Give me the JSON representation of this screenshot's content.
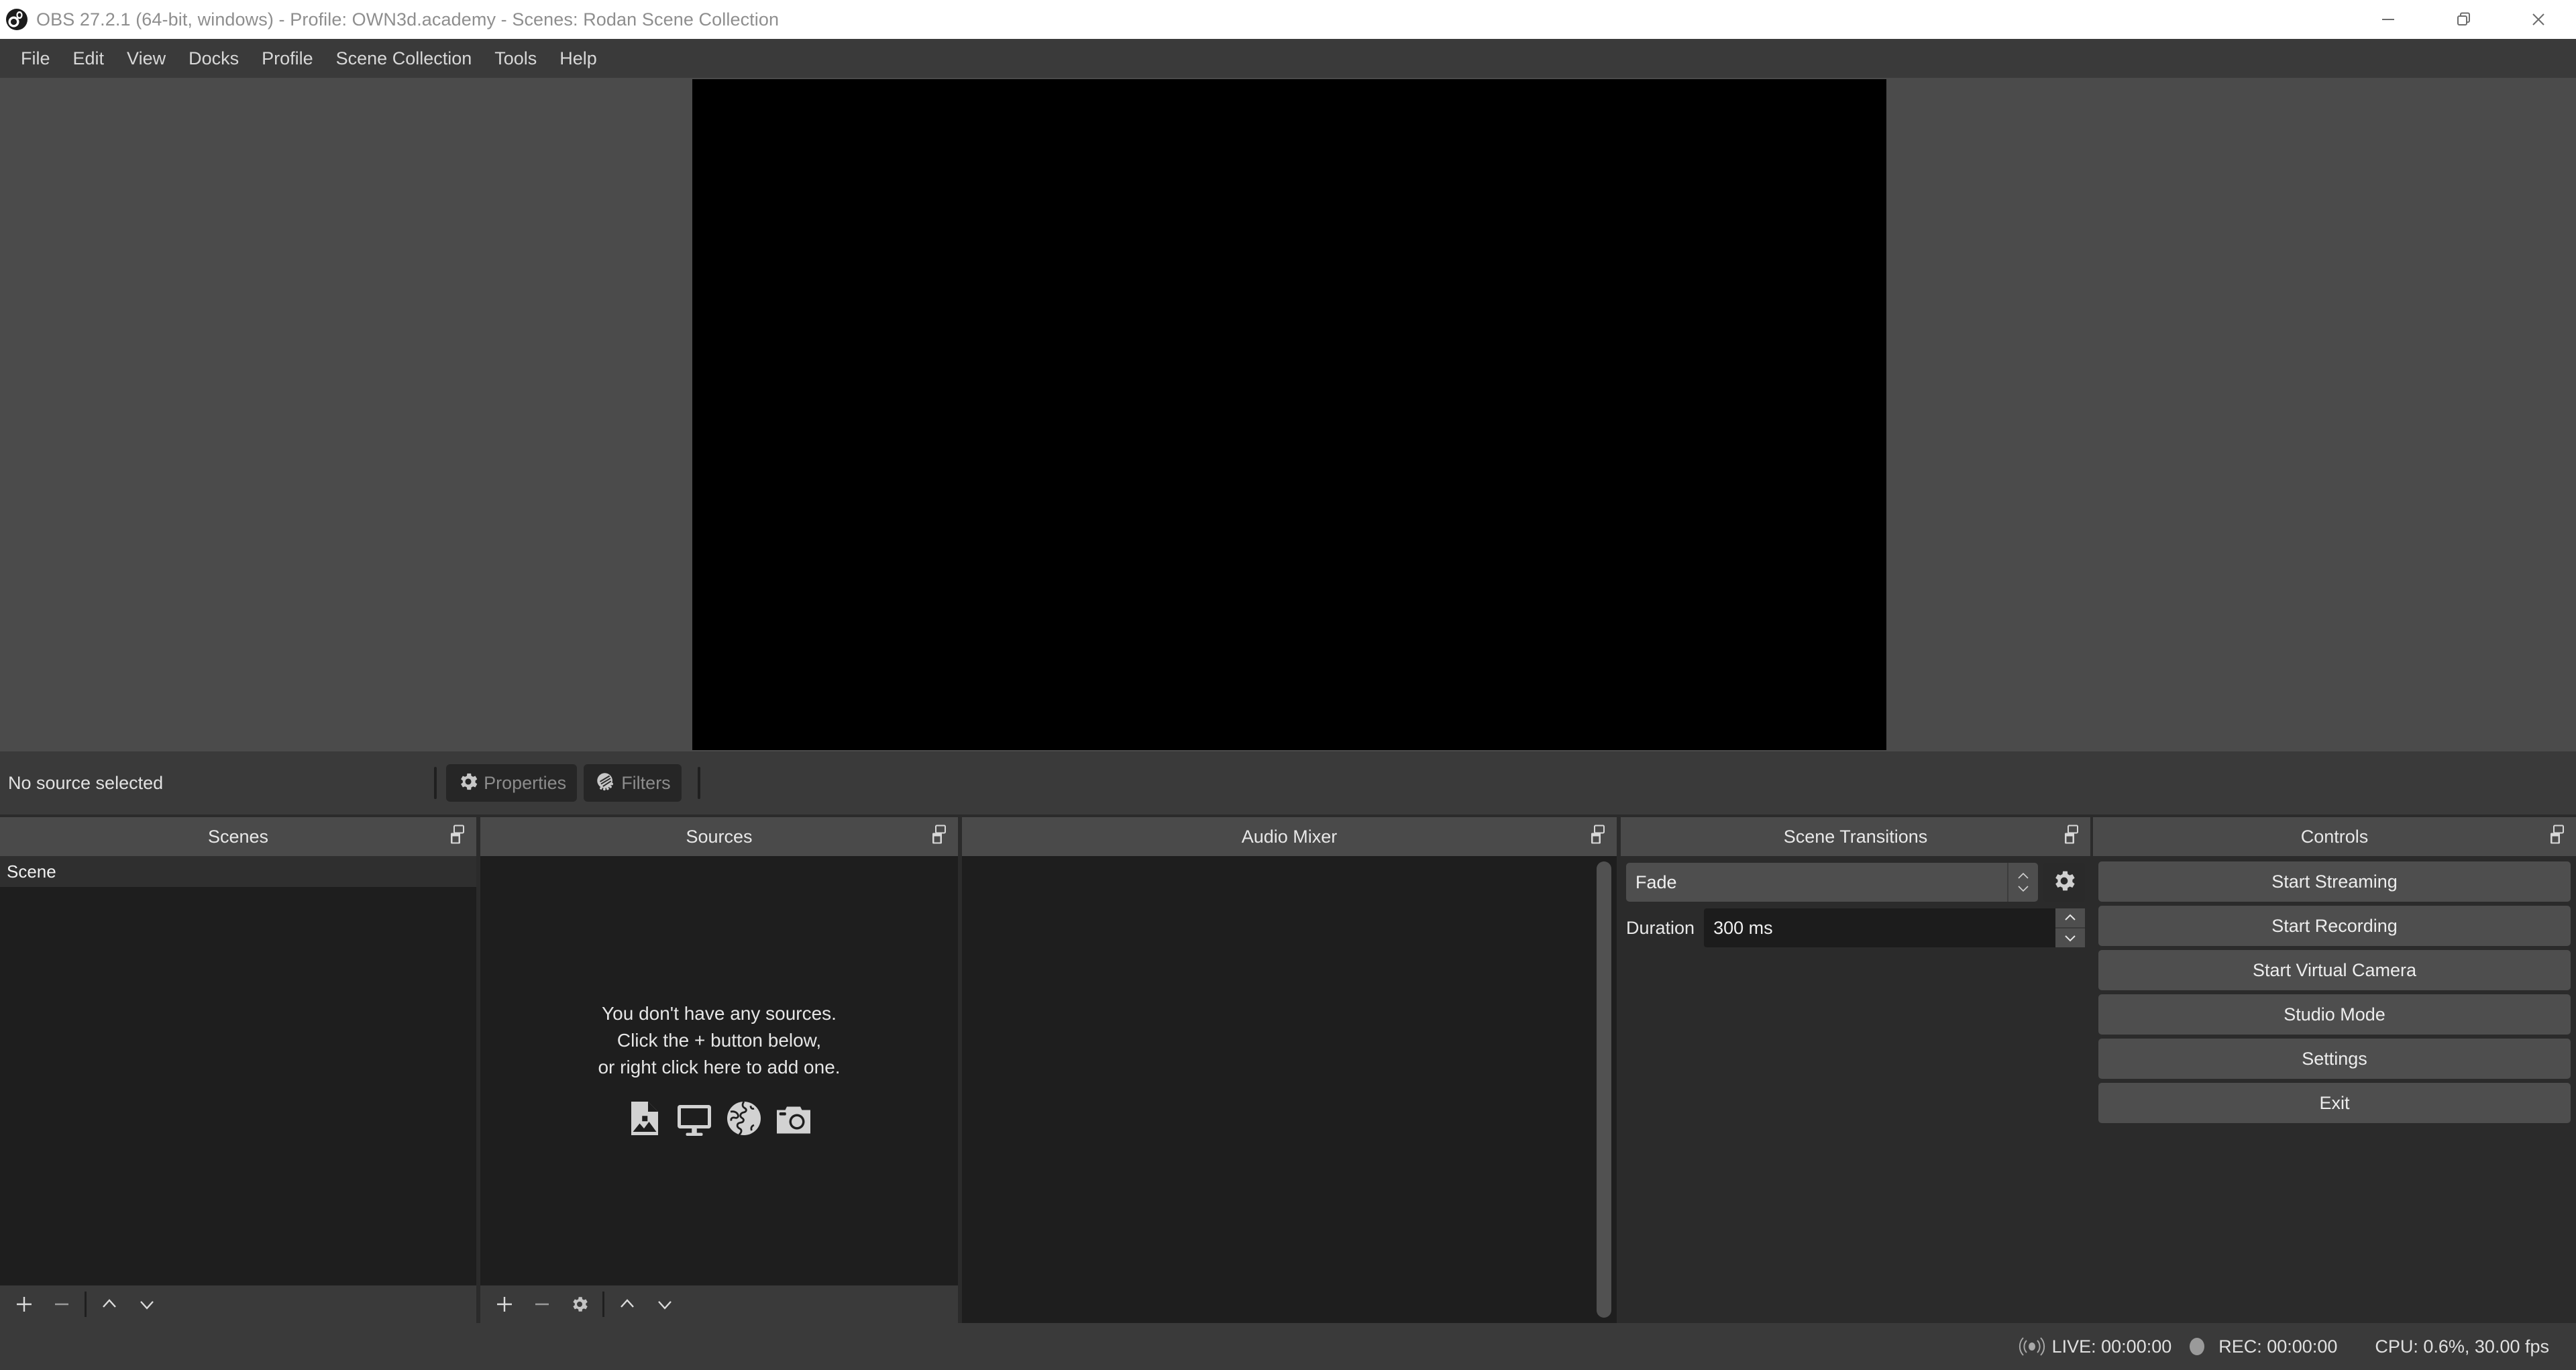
{
  "titlebar": {
    "title": "OBS 27.2.1 (64-bit, windows) - Profile: OWN3d.academy - Scenes: Rodan Scene Collection",
    "logo_icon": "obs-logo-icon",
    "minimize_icon": "minimize-icon",
    "restore_icon": "restore-icon",
    "close_icon": "close-icon"
  },
  "menubar": {
    "items": [
      {
        "label": "File"
      },
      {
        "label": "Edit"
      },
      {
        "label": "View"
      },
      {
        "label": "Docks"
      },
      {
        "label": "Profile"
      },
      {
        "label": "Scene Collection"
      },
      {
        "label": "Tools"
      },
      {
        "label": "Help"
      }
    ]
  },
  "preview": {
    "canvas_color": "#000000",
    "background_color": "#4b4b4b"
  },
  "source_toolbar": {
    "status_label": "No source selected",
    "properties_label": "Properties",
    "properties_icon": "gear-icon",
    "filters_label": "Filters",
    "filters_icon": "filters-icon"
  },
  "scenes_dock": {
    "title": "Scenes",
    "float_icon": "undock-icon",
    "items": [
      {
        "label": "Scene",
        "selected": true
      }
    ],
    "footer": {
      "add_icon": "plus-icon",
      "remove_icon": "minus-icon",
      "up_icon": "chevron-up-icon",
      "down_icon": "chevron-down-icon"
    }
  },
  "sources_dock": {
    "title": "Sources",
    "float_icon": "undock-icon",
    "empty_state": {
      "line1": "You don't have any sources.",
      "line2": "Click the + button below,",
      "line3": "or right click here to add one.",
      "icons": [
        "image-source-icon",
        "display-capture-icon",
        "browser-source-icon",
        "camera-source-icon"
      ]
    },
    "footer": {
      "add_icon": "plus-icon",
      "remove_icon": "minus-icon",
      "settings_icon": "gear-icon",
      "up_icon": "chevron-up-icon",
      "down_icon": "chevron-down-icon"
    }
  },
  "audio_mixer_dock": {
    "title": "Audio Mixer",
    "float_icon": "undock-icon",
    "scrollbar_visible": true
  },
  "scene_transitions_dock": {
    "title": "Scene Transitions",
    "float_icon": "undock-icon",
    "transition_value": "Fade",
    "transition_options": [
      "Fade"
    ],
    "transition_spinner_icon": "spinner-updown-icon",
    "gear_icon": "gear-icon",
    "duration_label": "Duration",
    "duration_value": "300 ms",
    "duration_up_icon": "chevron-up-icon",
    "duration_down_icon": "chevron-down-icon"
  },
  "controls_dock": {
    "title": "Controls",
    "float_icon": "undock-icon",
    "buttons": [
      {
        "label": "Start Streaming"
      },
      {
        "label": "Start Recording"
      },
      {
        "label": "Start Virtual Camera"
      },
      {
        "label": "Studio Mode"
      },
      {
        "label": "Settings"
      },
      {
        "label": "Exit"
      }
    ]
  },
  "statusbar": {
    "live_icon": "broadcast-icon",
    "live_text": "LIVE: 00:00:00",
    "rec_icon": "record-dot-icon",
    "rec_text": "REC: 00:00:00",
    "cpu_text": "CPU: 0.6%, 30.00 fps"
  },
  "colors": {
    "titlebar_bg": "#ffffff",
    "menubar_bg": "#3a3a3a",
    "dock_header_bg": "#4a4a4a",
    "dock_body_bg": "#1e1e1e",
    "button_bg": "#4e4e4e",
    "window_bg": "#2b2b2b"
  }
}
